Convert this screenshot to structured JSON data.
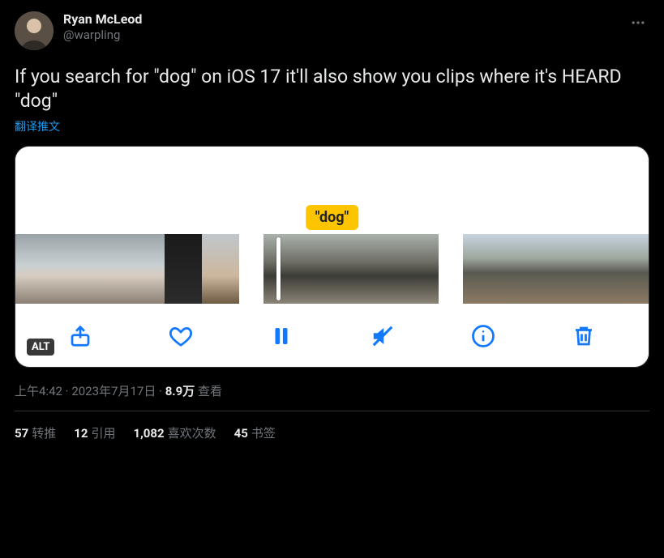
{
  "author": {
    "display_name": "Ryan McLeod",
    "handle": "@warpling"
  },
  "body_text": "If you search for \"dog\" on iOS 17 it'll also show you clips where it's HEARD \"dog\"",
  "translate_label": "翻译推文",
  "media": {
    "bubble_text": "\"dog\"",
    "alt_badge": "ALT",
    "toolbar": {
      "share_label": "share",
      "like_label": "like",
      "pause_label": "pause",
      "mute_label": "mute",
      "info_label": "info",
      "delete_label": "delete"
    }
  },
  "meta": {
    "time": "上午4:42",
    "dot1": " · ",
    "date": "2023年7月17日",
    "dot2": " · ",
    "views_count": "8.9万",
    "views_label": " 查看"
  },
  "stats": {
    "retweets_count": "57",
    "retweets_label": "转推",
    "quotes_count": "12",
    "quotes_label": "引用",
    "likes_count": "1,082",
    "likes_label": "喜欢次数",
    "bookmarks_count": "45",
    "bookmarks_label": "书签"
  }
}
